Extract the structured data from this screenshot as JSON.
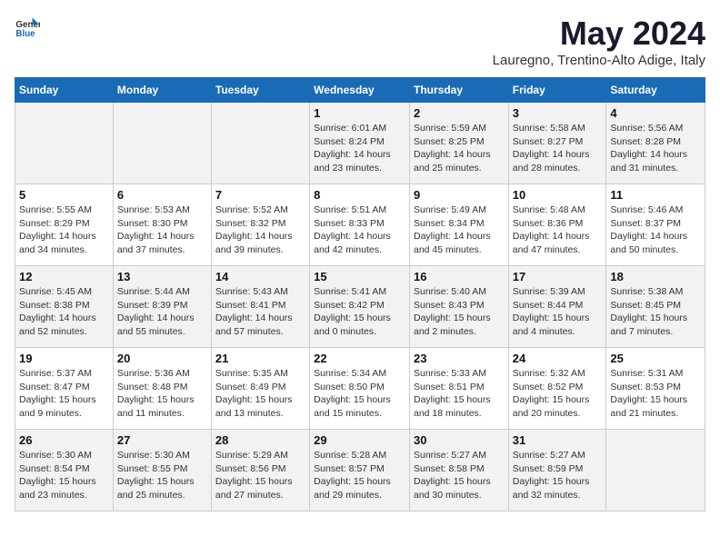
{
  "header": {
    "logo_general": "General",
    "logo_blue": "Blue",
    "month_year": "May 2024",
    "location": "Lauregno, Trentino-Alto Adige, Italy"
  },
  "days_of_week": [
    "Sunday",
    "Monday",
    "Tuesday",
    "Wednesday",
    "Thursday",
    "Friday",
    "Saturday"
  ],
  "weeks": [
    [
      {
        "day": "",
        "sunrise": "",
        "sunset": "",
        "daylight": ""
      },
      {
        "day": "",
        "sunrise": "",
        "sunset": "",
        "daylight": ""
      },
      {
        "day": "",
        "sunrise": "",
        "sunset": "",
        "daylight": ""
      },
      {
        "day": "1",
        "sunrise": "Sunrise: 6:01 AM",
        "sunset": "Sunset: 8:24 PM",
        "daylight": "Daylight: 14 hours and 23 minutes."
      },
      {
        "day": "2",
        "sunrise": "Sunrise: 5:59 AM",
        "sunset": "Sunset: 8:25 PM",
        "daylight": "Daylight: 14 hours and 25 minutes."
      },
      {
        "day": "3",
        "sunrise": "Sunrise: 5:58 AM",
        "sunset": "Sunset: 8:27 PM",
        "daylight": "Daylight: 14 hours and 28 minutes."
      },
      {
        "day": "4",
        "sunrise": "Sunrise: 5:56 AM",
        "sunset": "Sunset: 8:28 PM",
        "daylight": "Daylight: 14 hours and 31 minutes."
      }
    ],
    [
      {
        "day": "5",
        "sunrise": "Sunrise: 5:55 AM",
        "sunset": "Sunset: 8:29 PM",
        "daylight": "Daylight: 14 hours and 34 minutes."
      },
      {
        "day": "6",
        "sunrise": "Sunrise: 5:53 AM",
        "sunset": "Sunset: 8:30 PM",
        "daylight": "Daylight: 14 hours and 37 minutes."
      },
      {
        "day": "7",
        "sunrise": "Sunrise: 5:52 AM",
        "sunset": "Sunset: 8:32 PM",
        "daylight": "Daylight: 14 hours and 39 minutes."
      },
      {
        "day": "8",
        "sunrise": "Sunrise: 5:51 AM",
        "sunset": "Sunset: 8:33 PM",
        "daylight": "Daylight: 14 hours and 42 minutes."
      },
      {
        "day": "9",
        "sunrise": "Sunrise: 5:49 AM",
        "sunset": "Sunset: 8:34 PM",
        "daylight": "Daylight: 14 hours and 45 minutes."
      },
      {
        "day": "10",
        "sunrise": "Sunrise: 5:48 AM",
        "sunset": "Sunset: 8:36 PM",
        "daylight": "Daylight: 14 hours and 47 minutes."
      },
      {
        "day": "11",
        "sunrise": "Sunrise: 5:46 AM",
        "sunset": "Sunset: 8:37 PM",
        "daylight": "Daylight: 14 hours and 50 minutes."
      }
    ],
    [
      {
        "day": "12",
        "sunrise": "Sunrise: 5:45 AM",
        "sunset": "Sunset: 8:38 PM",
        "daylight": "Daylight: 14 hours and 52 minutes."
      },
      {
        "day": "13",
        "sunrise": "Sunrise: 5:44 AM",
        "sunset": "Sunset: 8:39 PM",
        "daylight": "Daylight: 14 hours and 55 minutes."
      },
      {
        "day": "14",
        "sunrise": "Sunrise: 5:43 AM",
        "sunset": "Sunset: 8:41 PM",
        "daylight": "Daylight: 14 hours and 57 minutes."
      },
      {
        "day": "15",
        "sunrise": "Sunrise: 5:41 AM",
        "sunset": "Sunset: 8:42 PM",
        "daylight": "Daylight: 15 hours and 0 minutes."
      },
      {
        "day": "16",
        "sunrise": "Sunrise: 5:40 AM",
        "sunset": "Sunset: 8:43 PM",
        "daylight": "Daylight: 15 hours and 2 minutes."
      },
      {
        "day": "17",
        "sunrise": "Sunrise: 5:39 AM",
        "sunset": "Sunset: 8:44 PM",
        "daylight": "Daylight: 15 hours and 4 minutes."
      },
      {
        "day": "18",
        "sunrise": "Sunrise: 5:38 AM",
        "sunset": "Sunset: 8:45 PM",
        "daylight": "Daylight: 15 hours and 7 minutes."
      }
    ],
    [
      {
        "day": "19",
        "sunrise": "Sunrise: 5:37 AM",
        "sunset": "Sunset: 8:47 PM",
        "daylight": "Daylight: 15 hours and 9 minutes."
      },
      {
        "day": "20",
        "sunrise": "Sunrise: 5:36 AM",
        "sunset": "Sunset: 8:48 PM",
        "daylight": "Daylight: 15 hours and 11 minutes."
      },
      {
        "day": "21",
        "sunrise": "Sunrise: 5:35 AM",
        "sunset": "Sunset: 8:49 PM",
        "daylight": "Daylight: 15 hours and 13 minutes."
      },
      {
        "day": "22",
        "sunrise": "Sunrise: 5:34 AM",
        "sunset": "Sunset: 8:50 PM",
        "daylight": "Daylight: 15 hours and 15 minutes."
      },
      {
        "day": "23",
        "sunrise": "Sunrise: 5:33 AM",
        "sunset": "Sunset: 8:51 PM",
        "daylight": "Daylight: 15 hours and 18 minutes."
      },
      {
        "day": "24",
        "sunrise": "Sunrise: 5:32 AM",
        "sunset": "Sunset: 8:52 PM",
        "daylight": "Daylight: 15 hours and 20 minutes."
      },
      {
        "day": "25",
        "sunrise": "Sunrise: 5:31 AM",
        "sunset": "Sunset: 8:53 PM",
        "daylight": "Daylight: 15 hours and 21 minutes."
      }
    ],
    [
      {
        "day": "26",
        "sunrise": "Sunrise: 5:30 AM",
        "sunset": "Sunset: 8:54 PM",
        "daylight": "Daylight: 15 hours and 23 minutes."
      },
      {
        "day": "27",
        "sunrise": "Sunrise: 5:30 AM",
        "sunset": "Sunset: 8:55 PM",
        "daylight": "Daylight: 15 hours and 25 minutes."
      },
      {
        "day": "28",
        "sunrise": "Sunrise: 5:29 AM",
        "sunset": "Sunset: 8:56 PM",
        "daylight": "Daylight: 15 hours and 27 minutes."
      },
      {
        "day": "29",
        "sunrise": "Sunrise: 5:28 AM",
        "sunset": "Sunset: 8:57 PM",
        "daylight": "Daylight: 15 hours and 29 minutes."
      },
      {
        "day": "30",
        "sunrise": "Sunrise: 5:27 AM",
        "sunset": "Sunset: 8:58 PM",
        "daylight": "Daylight: 15 hours and 30 minutes."
      },
      {
        "day": "31",
        "sunrise": "Sunrise: 5:27 AM",
        "sunset": "Sunset: 8:59 PM",
        "daylight": "Daylight: 15 hours and 32 minutes."
      },
      {
        "day": "",
        "sunrise": "",
        "sunset": "",
        "daylight": ""
      }
    ]
  ]
}
